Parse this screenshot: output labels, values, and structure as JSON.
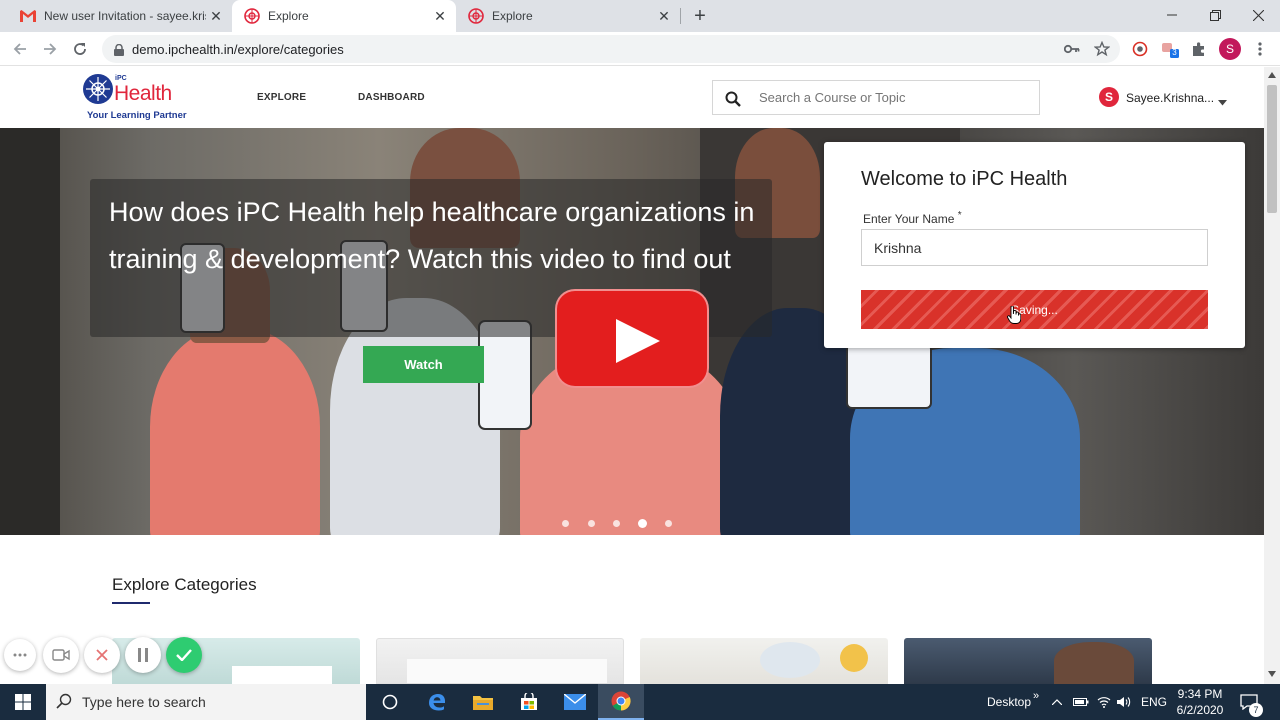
{
  "browser": {
    "tabs": [
      {
        "title": "New user Invitation - sayee.krishr",
        "icon": "gmail-icon",
        "close": "✕"
      },
      {
        "title": "Explore",
        "icon": "ipc-health-icon",
        "close": "✕"
      },
      {
        "title": "Explore",
        "icon": "ipc-health-icon",
        "close": "✕"
      }
    ],
    "new_tab": "+",
    "url": "demo.ipchealth.in/explore/categories",
    "profile_initial": "S",
    "extension_badge": "3"
  },
  "site": {
    "logo": {
      "brand": "Health",
      "prefix": "iPC",
      "tagline": "Your Learning Partner"
    },
    "nav": [
      "EXPLORE",
      "DASHBOARD"
    ],
    "search_placeholder": "Search a Course or Topic",
    "user_initial": "S",
    "user_name": "Sayee.Krishna...",
    "colors": {
      "brand": "#1f3a93",
      "brand_red": "#e0263c",
      "watch": "#34a853",
      "saving": "#d9322a"
    }
  },
  "hero": {
    "headline": "How does iPC Health help healthcare organizations in training & development? Watch this video to find out",
    "watch_label": "Watch",
    "slides": 5,
    "active_slide": 4
  },
  "welcome": {
    "title": "Welcome to iPC Health",
    "name_label": "Enter Your Name",
    "required_mark": "*",
    "name_value": "Krishna",
    "button_label": "Saving..."
  },
  "explore": {
    "title": "Explore Categories"
  },
  "taskbar": {
    "search_placeholder": "Type here to search",
    "desktop_label": "Desktop",
    "language": "ENG",
    "time": "9:34 PM",
    "date": "6/2/2020",
    "notification_count": "7"
  }
}
